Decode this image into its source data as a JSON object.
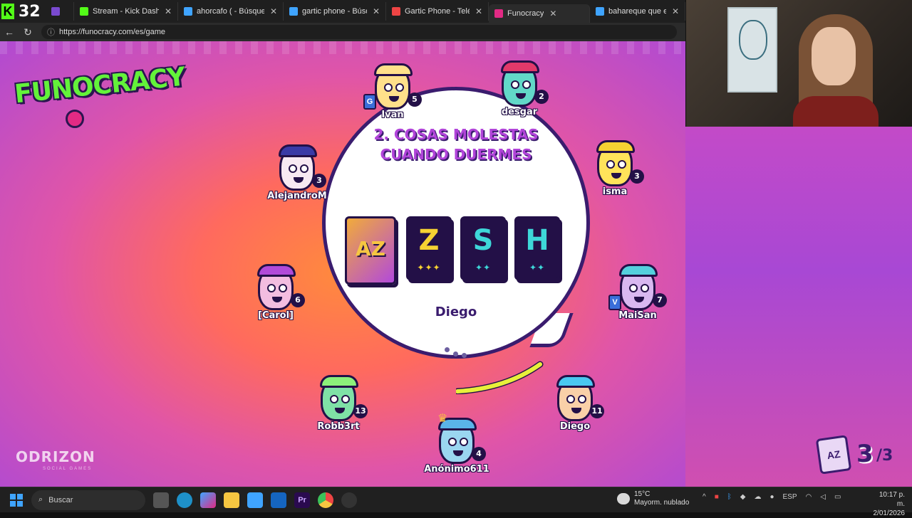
{
  "browser": {
    "kick_counter": "32",
    "tabs": [
      {
        "label": "",
        "color": "#7a4ad0"
      },
      {
        "label": "Stream - Kick Dashboard",
        "color": "#53fc18"
      },
      {
        "label": "ahorcafo ( - Búsqueda",
        "color": "#3fa4ff"
      },
      {
        "label": "gartic phone - Búsqueda",
        "color": "#3fa4ff"
      },
      {
        "label": "Gartic Phone - Teléfono D",
        "color": "#e44"
      },
      {
        "label": "Funocracy",
        "color": "#e22a84"
      },
      {
        "label": "bahareque que es - Búsq",
        "color": "#3fa4ff"
      }
    ],
    "url": "https://funocracy.com/es/game"
  },
  "game": {
    "logo": "FUNOCRACY",
    "prompt_title_line1": "2. COSAS MOLESTAS",
    "prompt_title_line2": "CUANDO DUERMES",
    "cards": [
      {
        "letter": "AZ",
        "stars": ""
      },
      {
        "letter": "Z",
        "stars": "✦✦✦"
      },
      {
        "letter": "S",
        "stars": "✦✦"
      },
      {
        "letter": "H",
        "stars": "✦✦"
      }
    ],
    "current_answerer": "Diego",
    "timer_color": "#e8f03a",
    "players": [
      {
        "name": "Ivan",
        "score": "5",
        "color": "#ffe08a",
        "hair": "#ffe08a",
        "badge": "G",
        "badge_color": "#3a6ed9"
      },
      {
        "name": "desgar",
        "score": "2",
        "color": "#62d8c8",
        "hair": "#e2396a",
        "badge": "",
        "badge_color": ""
      },
      {
        "name": "AlejandroM",
        "score": "3",
        "color": "#f7e9f2",
        "hair": "#3a3aa6",
        "badge": "",
        "badge_color": ""
      },
      {
        "name": "isma",
        "score": "3",
        "color": "#ffe35a",
        "hair": "#f6d232",
        "badge": "",
        "badge_color": ""
      },
      {
        "name": "[Carol]",
        "score": "6",
        "color": "#f3bde0",
        "hair": "#b14ad9",
        "badge": "",
        "badge_color": ""
      },
      {
        "name": "MaiSan",
        "score": "7",
        "color": "#d9b8f0",
        "hair": "#54d0dd",
        "badge": "V",
        "badge_color": "#3a6ed9"
      },
      {
        "name": "Robb3rt",
        "score": "13",
        "color": "#7fe1a6",
        "hair": "#8cf07a",
        "badge": "",
        "badge_color": ""
      },
      {
        "name": "Diego",
        "score": "11",
        "color": "#f9d0a8",
        "hair": "#4ac8f0",
        "badge": "",
        "badge_color": ""
      },
      {
        "name": "Anónimo611",
        "score": "4",
        "color": "#9ad6f0",
        "hair": "#5ab4e8",
        "badge": "",
        "badge_color": ""
      }
    ],
    "brand": "ODRIZON",
    "brand_sub": "SOCIAL GAMES",
    "round_current": "3",
    "round_total": "/3",
    "round_icon": "AZ"
  },
  "taskbar": {
    "search_placeholder": "Buscar",
    "weather_temp": "15°C",
    "weather_desc": "Mayorm. nublado",
    "lang": "ESP",
    "time": "10:17 p. m.",
    "date": "2/01/2026"
  }
}
